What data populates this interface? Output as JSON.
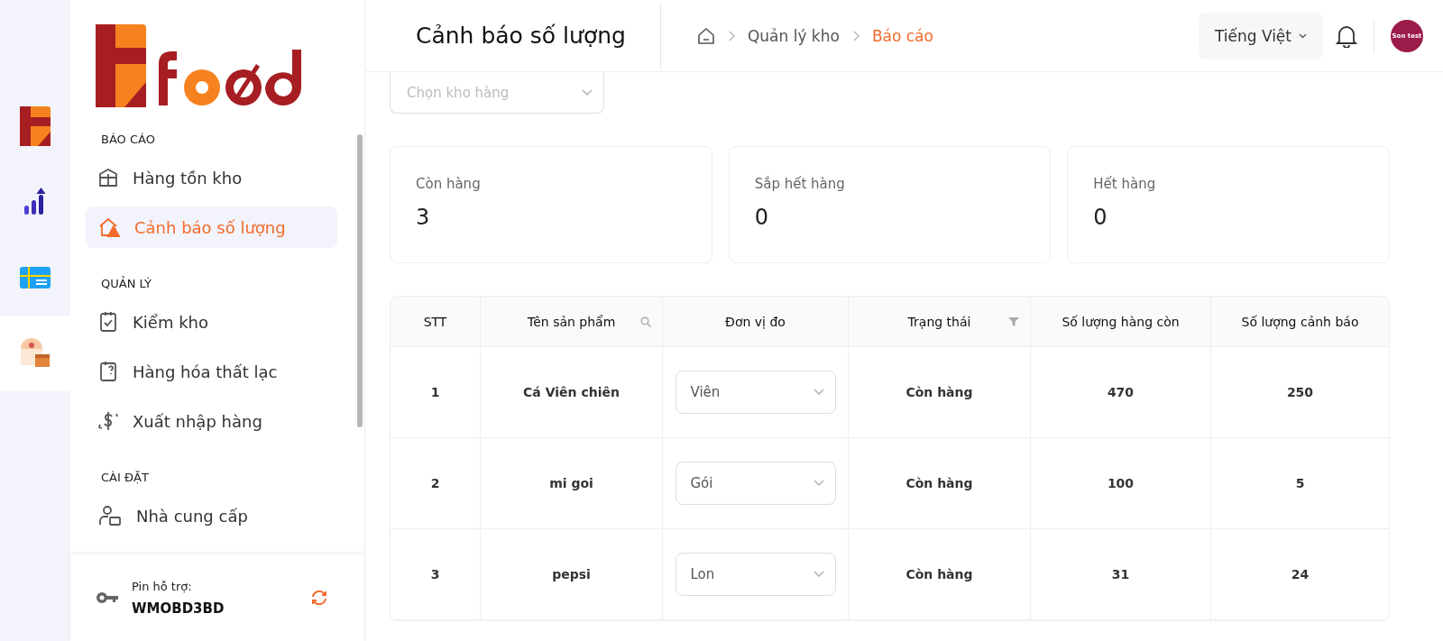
{
  "rail": [
    {
      "kind": "logo",
      "selected": false
    },
    {
      "kind": "chart",
      "selected": false
    },
    {
      "kind": "card",
      "selected": false
    },
    {
      "kind": "warehouse",
      "selected": true
    }
  ],
  "sidebar": {
    "sections": [
      {
        "title": "BÁO CÁO",
        "items": [
          {
            "label": "Hàng tồn kho",
            "kind": "grid",
            "selected": false
          },
          {
            "label": "Cảnh báo số lượng",
            "kind": "alert",
            "selected": true
          }
        ]
      },
      {
        "title": "QUẢN LÝ",
        "items": [
          {
            "label": "Kiểm kho",
            "kind": "check",
            "selected": false
          },
          {
            "label": "Hàng hóa thất lạc",
            "kind": "lost",
            "selected": false
          },
          {
            "label": "Xuất nhập hàng",
            "kind": "dollar",
            "selected": false
          }
        ]
      },
      {
        "title": "CÀI ĐẶT",
        "items": [
          {
            "label": "Nhà cung cấp",
            "kind": "supplier",
            "selected": false
          }
        ]
      }
    ],
    "pin_label": "Pin hỗ trợ:",
    "pin_code": "WMOBD3BD"
  },
  "header": {
    "title": "Cảnh báo số lượng",
    "breadcrumb": [
      {
        "label": "Quản lý kho",
        "current": false
      },
      {
        "label": "Báo cáo",
        "current": true
      }
    ],
    "language": "Tiếng Việt",
    "avatar": "Son test"
  },
  "warehouse_select": {
    "placeholder": "Chọn kho hàng"
  },
  "stats": [
    {
      "label": "Còn hàng",
      "value": "3"
    },
    {
      "label": "Sắp hết hàng",
      "value": "0"
    },
    {
      "label": "Hết hàng",
      "value": "0"
    }
  ],
  "table": {
    "columns": [
      {
        "label": "STT",
        "kind": "plain"
      },
      {
        "label": "Tên sản phẩm",
        "kind": "search"
      },
      {
        "label": "Đơn vị đo",
        "kind": "plain"
      },
      {
        "label": "Trạng thái",
        "kind": "filter"
      },
      {
        "label": "Số lượng hàng còn",
        "kind": "plain"
      },
      {
        "label": "Số lượng cảnh báo",
        "kind": "plain"
      }
    ],
    "rows": [
      {
        "stt": "1",
        "name": "Cá Viên chiên",
        "unit": "Viên",
        "status": "Còn hàng",
        "remaining": "470",
        "warning": "250"
      },
      {
        "stt": "2",
        "name": "mi goi",
        "unit": "Gói",
        "status": "Còn hàng",
        "remaining": "100",
        "warning": "5"
      },
      {
        "stt": "3",
        "name": "pepsi",
        "unit": "Lon",
        "status": "Còn hàng",
        "remaining": "31",
        "warning": "24"
      }
    ]
  }
}
